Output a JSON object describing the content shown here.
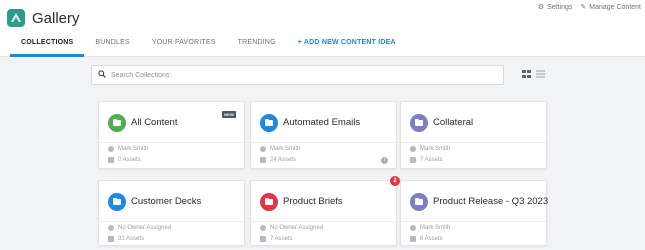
{
  "app": {
    "title": "Gallery",
    "logo_icon": "gallery-logo-icon",
    "logo_color": "#2a9d8f"
  },
  "top_links": {
    "settings": "Settings",
    "manage_content": "Manage Content"
  },
  "tabs": [
    {
      "label": "COLLECTIONS",
      "active": true
    },
    {
      "label": "BUNDLES",
      "active": false
    },
    {
      "label": "YOUR FAVORITES",
      "active": false
    },
    {
      "label": "TRENDING",
      "active": false
    }
  ],
  "add_content_idea": "+ ADD NEW CONTENT IDEA",
  "search": {
    "placeholder": "Search Collections",
    "value": ""
  },
  "view_modes": [
    "grid",
    "list"
  ],
  "accent_color": "#1a8ad6",
  "collections": [
    {
      "title": "All Content",
      "owner": "Mark Smith",
      "assets": "0 Assets",
      "color": "#4caf50",
      "badge": "NEW"
    },
    {
      "title": "Automated Emails",
      "owner": "Mark Smith",
      "assets": "24 Assets",
      "color": "#1e88e5",
      "info_icon": true
    },
    {
      "title": "Collateral",
      "owner": "Mark Smith",
      "assets": "7 Assets",
      "color": "#7b7fc4"
    },
    {
      "title": "Customer Decks",
      "owner": "No Owner Assigned",
      "assets": "31 Assets",
      "color": "#1e88e5"
    },
    {
      "title": "Product Briefs",
      "owner": "No Owner Assigned",
      "assets": "7 Assets",
      "color": "#e03545",
      "count": "2"
    },
    {
      "title": "Product Release - Q3 2023",
      "owner": "Mark Smith",
      "assets": "6 Assets",
      "color": "#7b7fc4"
    }
  ]
}
